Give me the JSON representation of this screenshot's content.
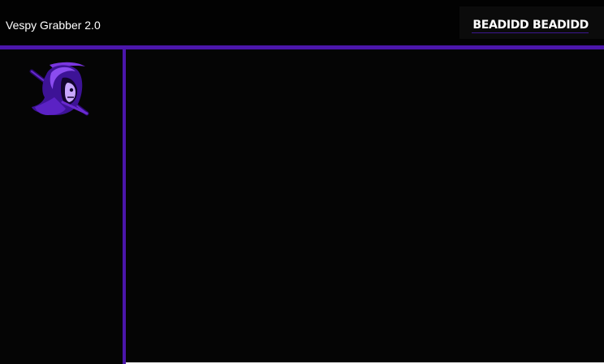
{
  "app": {
    "title": "Vespy Grabber 2.0"
  },
  "user": {
    "display_name": "BEADIDD BEADIDD"
  },
  "logo": {
    "icon": "hooded-reaper-logo-icon"
  },
  "colors": {
    "accent": "#4b16ab",
    "background": "#050505",
    "text": "#ffffff"
  }
}
